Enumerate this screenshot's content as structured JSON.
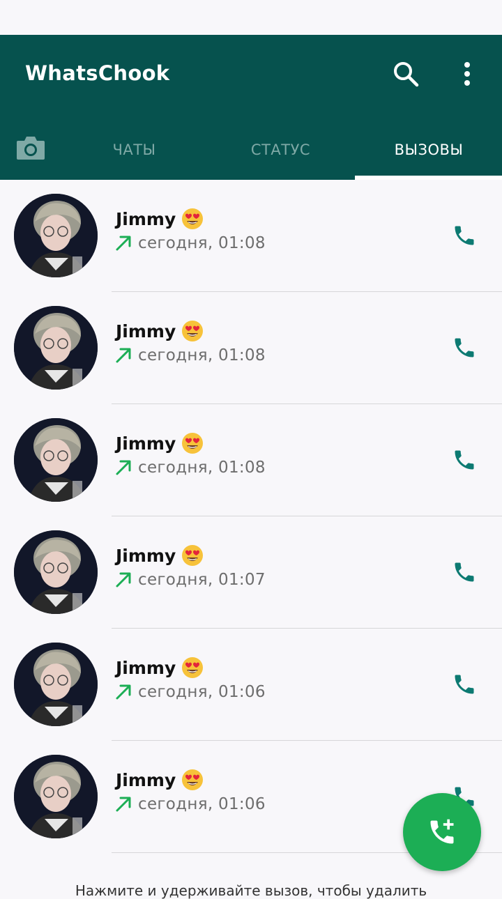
{
  "app": {
    "title": "WhatsChook"
  },
  "toolbar": {
    "search_icon": "search-icon",
    "menu_icon": "more-vert-icon"
  },
  "tabs": [
    {
      "label": "ЧАТЫ",
      "active": false
    },
    {
      "label": "СТАТУС",
      "active": false
    },
    {
      "label": "ВЫЗОВЫ",
      "active": true
    }
  ],
  "colors": {
    "header": "#06524e",
    "accent": "#1cae55",
    "call_icon": "#0d7a72",
    "outgoing_arrow": "#1cae55"
  },
  "calls": [
    {
      "name": "Jimmy",
      "emoji": "heart-eyes",
      "direction": "outgoing",
      "time": "сегодня, 01:08"
    },
    {
      "name": "Jimmy",
      "emoji": "heart-eyes",
      "direction": "outgoing",
      "time": "сегодня, 01:08"
    },
    {
      "name": "Jimmy",
      "emoji": "heart-eyes",
      "direction": "outgoing",
      "time": "сегодня, 01:08"
    },
    {
      "name": "Jimmy",
      "emoji": "heart-eyes",
      "direction": "outgoing",
      "time": "сегодня, 01:07"
    },
    {
      "name": "Jimmy",
      "emoji": "heart-eyes",
      "direction": "outgoing",
      "time": "сегодня, 01:06"
    },
    {
      "name": "Jimmy",
      "emoji": "heart-eyes",
      "direction": "outgoing",
      "time": "сегодня, 01:06"
    }
  ],
  "fab": {
    "icon": "add-call-icon"
  },
  "footer": {
    "hint": "Нажмите и удерживайте вызов, чтобы удалить"
  }
}
